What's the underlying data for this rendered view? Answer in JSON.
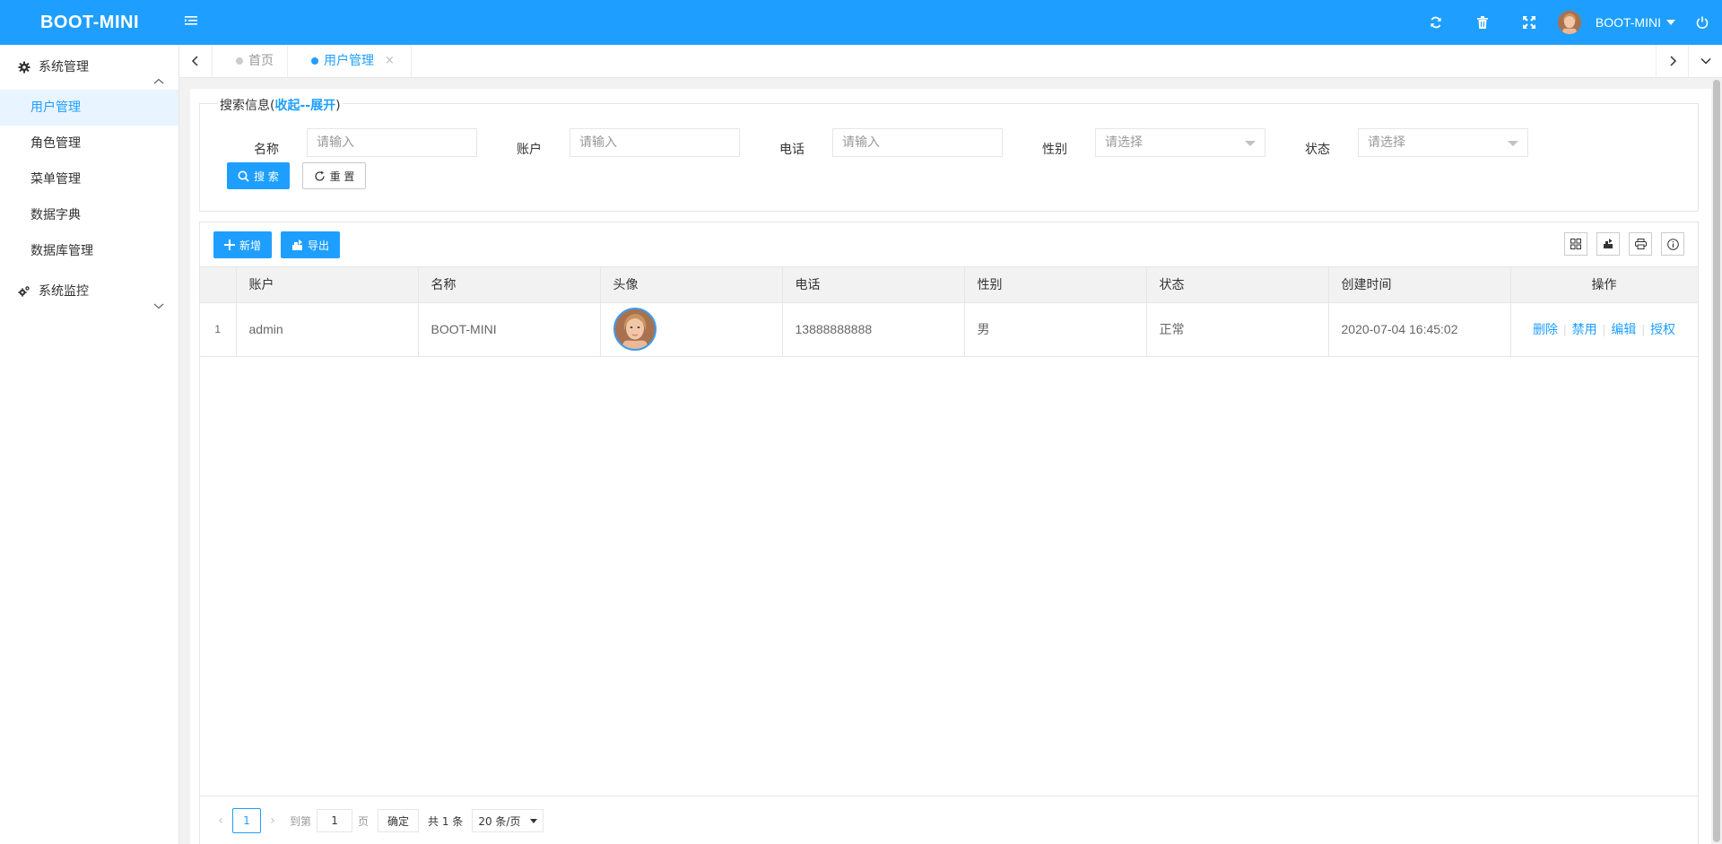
{
  "header": {
    "logo": "BOOT-MINI",
    "username": "BOOT-MINI",
    "icons": [
      "menu-toggle-icon",
      "refresh-icon",
      "trash-icon",
      "fullscreen-icon",
      "power-icon"
    ]
  },
  "sidebar": {
    "groups": [
      {
        "label": "系统管理",
        "expanded": true,
        "items": [
          {
            "label": "用户管理",
            "active": true
          },
          {
            "label": "角色管理"
          },
          {
            "label": "菜单管理"
          },
          {
            "label": "数据字典"
          },
          {
            "label": "数据库管理"
          }
        ]
      },
      {
        "label": "系统监控",
        "expanded": false,
        "items": []
      }
    ]
  },
  "tabs": [
    {
      "label": "首页",
      "active": false
    },
    {
      "label": "用户管理",
      "active": true,
      "close": "×"
    }
  ],
  "search": {
    "legend_prefix": "搜索信息(",
    "legend_toggle": "收起--展开",
    "legend_suffix": ")",
    "fields": [
      {
        "label": "名称",
        "placeholder": "请输入"
      },
      {
        "label": "账户",
        "placeholder": "请输入"
      },
      {
        "label": "电话",
        "placeholder": "请输入"
      },
      {
        "label": "性别",
        "placeholder": "请选择"
      },
      {
        "label": "状态",
        "placeholder": "请选择"
      }
    ],
    "search_button": "搜 索",
    "reset_button": "重 置"
  },
  "toolbar": {
    "add_button": "新增",
    "export_button": "导出",
    "right_icons": [
      "columns-icon",
      "export-file-icon",
      "print-icon",
      "info-icon"
    ]
  },
  "table": {
    "columns": [
      "",
      "账户",
      "名称",
      "头像",
      "电话",
      "性别",
      "状态",
      "创建时间",
      "操作"
    ],
    "rows": [
      {
        "num": "1",
        "account": "admin",
        "name": "BOOT-MINI",
        "phone": "13888888888",
        "sex": "男",
        "status": "正常",
        "created": "2020-07-04 16:45:02",
        "ops": [
          "删除",
          "禁用",
          "编辑",
          "授权"
        ]
      }
    ]
  },
  "pager": {
    "current": "1",
    "goto_label": "到第",
    "goto_value": "1",
    "page_unit": "页",
    "confirm": "确定",
    "total": "共 1 条",
    "page_size": "20 条/页"
  },
  "colors": {
    "primary": "#1e9fff",
    "active_bg": "#e8f4ff"
  }
}
